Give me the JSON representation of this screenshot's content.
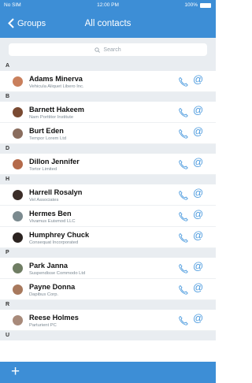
{
  "status": {
    "carrier": "No SIM",
    "time": "12:00 PM",
    "battery": "100%"
  },
  "nav": {
    "back_label": "Groups",
    "title": "All contacts"
  },
  "search": {
    "placeholder": "Search"
  },
  "colors": {
    "accent": "#3d8ed6",
    "icon_blue": "#4b9ade",
    "section_bg": "#e9edf1"
  },
  "sections": [
    {
      "letter": "A",
      "contacts": [
        {
          "name": "Adams Minerva",
          "company": "Vehicula Aliquet Libero Inc.",
          "avatar": "#c97f5c"
        }
      ]
    },
    {
      "letter": "B",
      "contacts": [
        {
          "name": "Barnett Hakeem",
          "company": "Nam Porttitor Institute",
          "avatar": "#7a4a32"
        },
        {
          "name": "Burt Eden",
          "company": "Tempor Lorem Ltd",
          "avatar": "#8a6d5e"
        }
      ]
    },
    {
      "letter": "D",
      "contacts": [
        {
          "name": "Dillon Jennifer",
          "company": "Tortor Limited",
          "avatar": "#b46a4a"
        }
      ]
    },
    {
      "letter": "H",
      "contacts": [
        {
          "name": "Harrell Rosalyn",
          "company": "Vel Associates",
          "avatar": "#3b2d28"
        },
        {
          "name": "Hermes Ben",
          "company": "Vivamus Euismod LLC",
          "avatar": "#7b8a8f"
        },
        {
          "name": "Humphrey Chuck",
          "company": "Consequat Incorporated",
          "avatar": "#2b2320"
        }
      ]
    },
    {
      "letter": "P",
      "contacts": [
        {
          "name": "Park Janna",
          "company": "Suspendisse Commodo Ltd",
          "avatar": "#6f7d63"
        },
        {
          "name": "Payne Donna",
          "company": "Dapibus Corp.",
          "avatar": "#a8795d"
        }
      ]
    },
    {
      "letter": "R",
      "contacts": [
        {
          "name": "Reese Holmes",
          "company": "Parturient PC",
          "avatar": "#a88a7a"
        }
      ]
    },
    {
      "letter": "U",
      "contacts": []
    }
  ],
  "bottom": {
    "add_label": "+"
  }
}
